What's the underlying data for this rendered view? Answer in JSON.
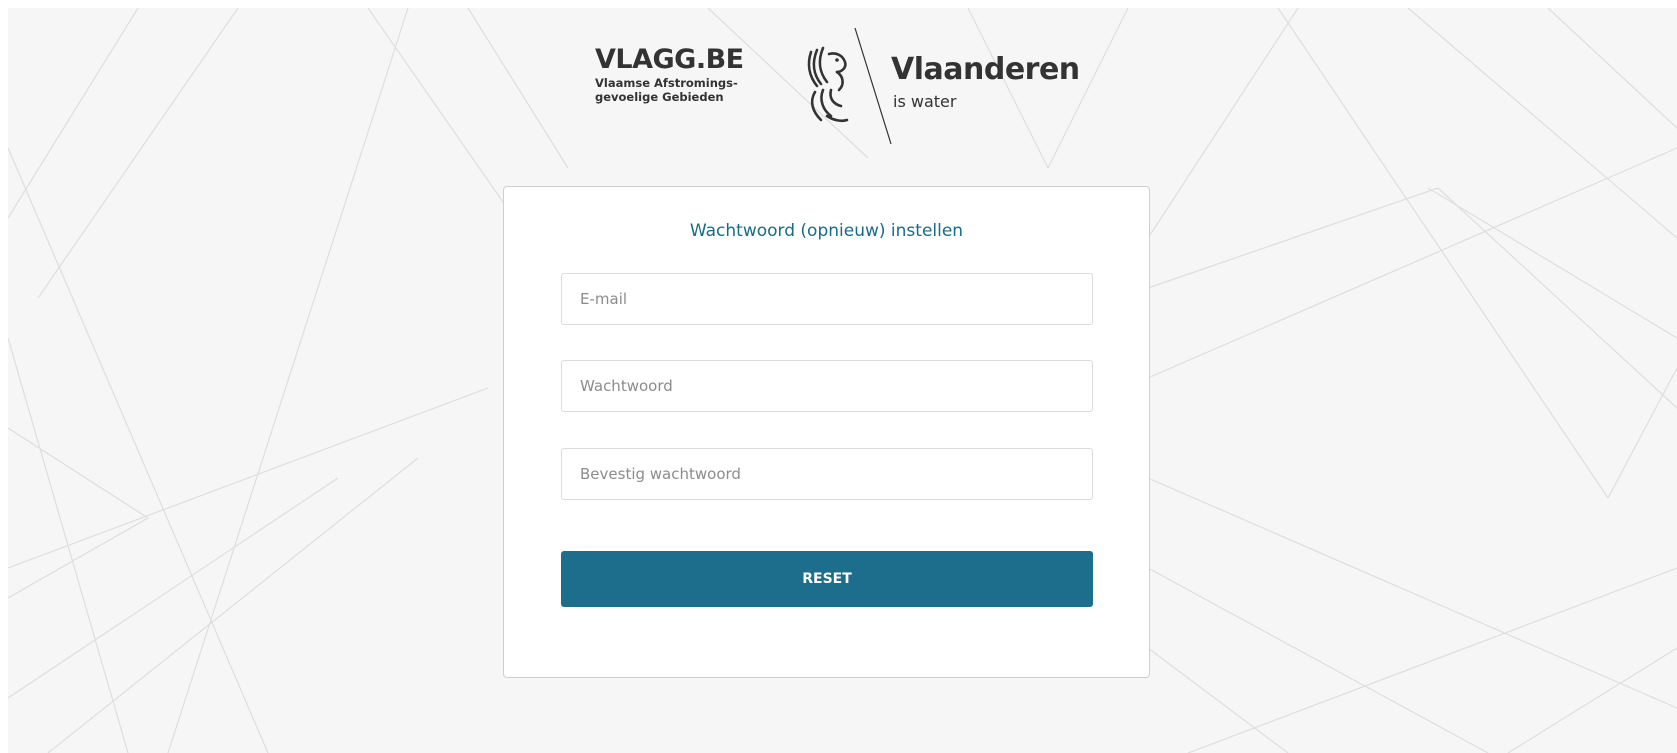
{
  "header": {
    "vlagg_logo": {
      "title": "VLAGG.BE",
      "subtitle_line1": "Vlaamse Afstromings-",
      "subtitle_line2": "gevoelige Gebieden"
    },
    "vlaanderen_logo": {
      "name": "Vlaanderen",
      "tagline": "is water",
      "icon": "flemish-lion-icon"
    }
  },
  "form": {
    "title": "Wachtwoord (opnieuw) instellen",
    "email": {
      "value": "",
      "placeholder": "E-mail"
    },
    "password": {
      "value": "",
      "placeholder": "Wachtwoord"
    },
    "confirm_password": {
      "value": "",
      "placeholder": "Bevestig wachtwoord"
    },
    "submit_label": "RESET"
  },
  "colors": {
    "accent": "#1c6e8c",
    "title": "#1a6a8a",
    "background": "#f6f6f6",
    "card": "#ffffff"
  }
}
